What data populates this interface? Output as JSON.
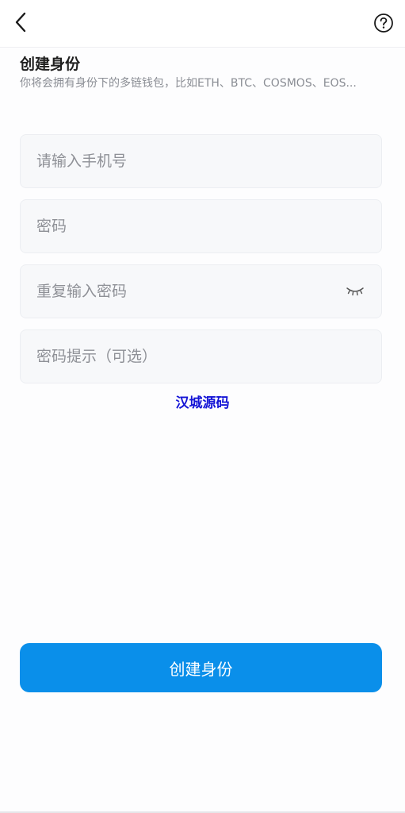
{
  "header": {
    "back_icon": "chevron-left-icon",
    "help_icon": "question-circle-icon"
  },
  "page": {
    "title": "创建身份",
    "subtitle": "你将会拥有身份下的多链钱包，比如ETH、BTC、COSMOS、EOS..."
  },
  "form": {
    "phone_placeholder": "请输入手机号",
    "password_placeholder": "密码",
    "repeat_password_placeholder": "重复输入密码",
    "eye_icon": "eye-closed-icon",
    "hint_placeholder": "密码提示（可选）"
  },
  "watermark": {
    "text": "汉城源码"
  },
  "submit": {
    "label": "创建身份"
  },
  "colors": {
    "accent": "#0a8fea",
    "watermark": "#1414d6",
    "field_bg": "#f7f8fa"
  }
}
